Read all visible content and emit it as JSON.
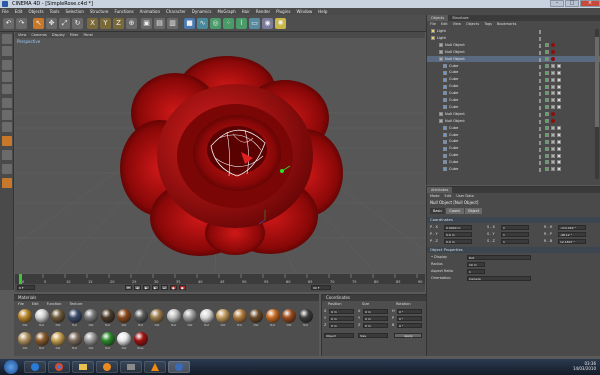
{
  "window": {
    "title": "CINEMA 4D - [SimpleRose.c4d *]",
    "min": "–",
    "max": "□",
    "close": "×"
  },
  "menubar": [
    "File",
    "Edit",
    "Objects",
    "Tools",
    "Selection",
    "Structure",
    "Functions",
    "Animation",
    "Character",
    "Dynamics",
    "MoGraph",
    "Hair",
    "Render",
    "Plugins",
    "Window",
    "Help"
  ],
  "viewport": {
    "menu": [
      "View",
      "Cameras",
      "Display",
      "Filter",
      "Panel"
    ],
    "label": "Perspective"
  },
  "timeline": {
    "ticks": [
      "0",
      "5",
      "10",
      "15",
      "20",
      "25",
      "30",
      "35",
      "40",
      "45",
      "50",
      "55",
      "60",
      "65",
      "70",
      "75",
      "80",
      "85",
      "90"
    ],
    "frame": "0 F",
    "end": "90 F"
  },
  "object_manager": {
    "tabs": [
      "Objects",
      "Structure"
    ],
    "menu": [
      "File",
      "Edit",
      "View",
      "Objects",
      "Tags",
      "Bookmarks"
    ],
    "rows": [
      {
        "name": "Light",
        "indent": 0,
        "tag": "none"
      },
      {
        "name": "Light",
        "indent": 0,
        "tag": "none"
      },
      {
        "name": "Null Object",
        "indent": 2,
        "tag": "mat"
      },
      {
        "name": "Null Object",
        "indent": 2,
        "tag": "mat"
      },
      {
        "name": "Null Object",
        "indent": 2,
        "tag": "mat"
      },
      {
        "name": "Cube",
        "indent": 3,
        "tag": "both"
      },
      {
        "name": "Cube",
        "indent": 3,
        "tag": "both"
      },
      {
        "name": "Cube",
        "indent": 3,
        "tag": "both"
      },
      {
        "name": "Cube",
        "indent": 3,
        "tag": "both"
      },
      {
        "name": "Cube",
        "indent": 3,
        "tag": "both"
      },
      {
        "name": "Cube",
        "indent": 3,
        "tag": "both"
      },
      {
        "name": "Cube",
        "indent": 3,
        "tag": "both"
      },
      {
        "name": "Null Object",
        "indent": 2,
        "tag": "mat"
      },
      {
        "name": "Null Object",
        "indent": 2,
        "tag": "mat"
      },
      {
        "name": "Cube",
        "indent": 3,
        "tag": "both"
      },
      {
        "name": "Cube",
        "indent": 3,
        "tag": "both"
      },
      {
        "name": "Cube",
        "indent": 3,
        "tag": "both"
      },
      {
        "name": "Cube",
        "indent": 3,
        "tag": "both"
      },
      {
        "name": "Cube",
        "indent": 3,
        "tag": "both"
      },
      {
        "name": "Cube",
        "indent": 3,
        "tag": "both"
      },
      {
        "name": "Cube",
        "indent": 3,
        "tag": "both"
      }
    ]
  },
  "attributes": {
    "tab": "Attributes",
    "menu": [
      "Mode",
      "Edit",
      "User Data"
    ],
    "object_title": "Null Object [Null Object]",
    "subtabs": [
      "Basic",
      "Coord.",
      "Object"
    ],
    "coord_header": "Coordinates",
    "coords": [
      {
        "a": "P . X",
        "va": "0.0000 m",
        "b": "S . X",
        "vb": "1",
        "c": "R . H",
        "vc": "-113.429 °"
      },
      {
        "a": "P . Y",
        "va": "0.0 m",
        "b": "S . Y",
        "vb": "1",
        "c": "R . P",
        "vc": "-48.12 °"
      },
      {
        "a": "P . Z",
        "va": "0.0 m",
        "b": "S . Z",
        "vb": "1",
        "c": "R . B",
        "vc": "12.1807 °"
      }
    ],
    "objprop_header": "Object Properties",
    "props": [
      {
        "label": "• Display",
        "value": "Dot"
      },
      {
        "label": "Radius",
        "value": "10 m"
      },
      {
        "label": "Aspect Ratio",
        "value": "1"
      },
      {
        "label": "Orientation",
        "value": "Camera"
      }
    ]
  },
  "materials": {
    "head": "Materials",
    "menu": [
      "File",
      "Edit",
      "Function",
      "Texture"
    ],
    "items": [
      {
        "name": "Mat",
        "color": "#b8862a"
      },
      {
        "name": "Mat",
        "color": "#d0d0d0"
      },
      {
        "name": "Mat",
        "color": "#6e5a3a"
      },
      {
        "name": "Mat",
        "color": "#3a4a6a"
      },
      {
        "name": "Mat",
        "color": "#7a7a7a"
      },
      {
        "name": "Mat",
        "color": "#4a3a2a"
      },
      {
        "name": "Mat",
        "color": "#8a4a1a"
      },
      {
        "name": "Mat",
        "color": "#5a5a5a"
      },
      {
        "name": "Mat",
        "color": "#9a7a4a"
      },
      {
        "name": "Mat",
        "color": "#c0c0c0"
      },
      {
        "name": "Mat",
        "color": "#a0a0a0"
      },
      {
        "name": "Mat",
        "color": "#d8d8d8"
      },
      {
        "name": "Mat",
        "color": "#c09a5a"
      },
      {
        "name": "Mat",
        "color": "#b07a3a"
      },
      {
        "name": "Mat",
        "color": "#6a4a2a"
      },
      {
        "name": "Mat",
        "color": "#c86a20"
      },
      {
        "name": "Mat",
        "color": "#9a4a1a"
      },
      {
        "name": "Mat",
        "color": "#3a3a3a"
      },
      {
        "name": "Mat",
        "color": "#b09060"
      },
      {
        "name": "Mat",
        "color": "#8a5a2a"
      },
      {
        "name": "Mat",
        "color": "#c8a050"
      },
      {
        "name": "Mat",
        "color": "#7a6a5a"
      },
      {
        "name": "Mat",
        "color": "#9a9a9a"
      },
      {
        "name": "Mat",
        "color": "#2a8a2a"
      },
      {
        "name": "Mat",
        "color": "#e8e8e8"
      },
      {
        "name": "Rose",
        "color": "#a01010"
      }
    ]
  },
  "coordinates": {
    "head": "Coordinates",
    "headers": [
      "Position",
      "Size",
      "Rotation"
    ],
    "rows": [
      {
        "a": "X",
        "va": "0 m",
        "b": "X",
        "vb": "0 m",
        "c": "H",
        "vc": "0 °"
      },
      {
        "a": "Y",
        "va": "0 m",
        "b": "Y",
        "vb": "0 m",
        "c": "P",
        "vc": "0 °"
      },
      {
        "a": "Z",
        "va": "0 m",
        "b": "Z",
        "vb": "0 m",
        "c": "B",
        "vc": "0 °"
      }
    ],
    "mode": "Object",
    "size_mode": "Size",
    "apply": "Apply"
  },
  "taskbar": {
    "time": "03:36",
    "date": "14/03/2010"
  }
}
